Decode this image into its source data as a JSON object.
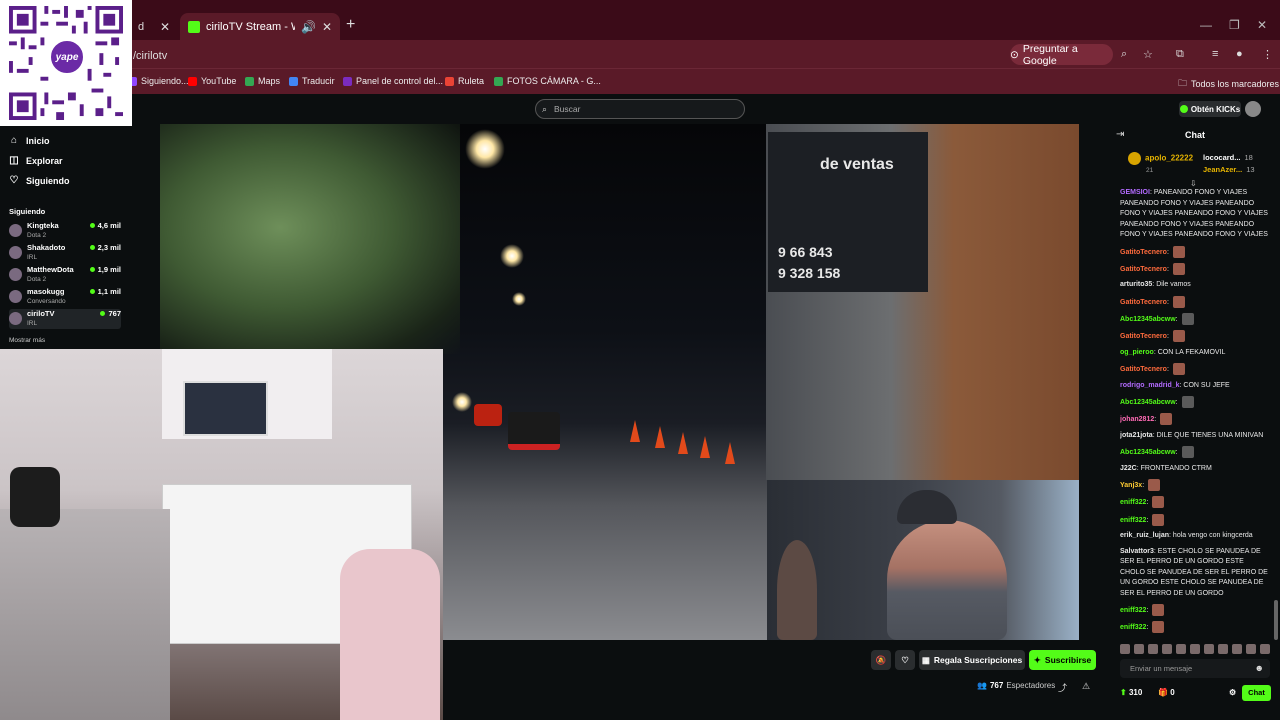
{
  "browser": {
    "tabs": [
      {
        "label": "d",
        "close": "✕"
      },
      {
        "label": "ciriloTV Stream - Watch Live",
        "close": "✕"
      }
    ],
    "new_tab": "+",
    "window_controls": [
      "—",
      "❐",
      "✕"
    ],
    "url": "/cirilotv",
    "google_button": "Preguntar a Google",
    "bookmarks": [
      {
        "label": "Siguiendo...",
        "color": "#9147ff"
      },
      {
        "label": "YouTube",
        "color": "#ff0000"
      },
      {
        "label": "Maps",
        "color": "#34a853"
      },
      {
        "label": "Traducir",
        "color": "#4285f4"
      },
      {
        "label": "Panel de control del...",
        "color": "#7b2cbf"
      },
      {
        "label": "Ruleta",
        "color": "#ea4335"
      },
      {
        "label": "FOTOS CÁMARA - G...",
        "color": "#34a853"
      }
    ],
    "all_bookmarks": "Todos los marcadores"
  },
  "qr": {
    "brand": "yape",
    "brand_color": "#6b2aa6"
  },
  "kick": {
    "search_placeholder": "Buscar",
    "kicks_button": "Obtén KICKs",
    "brand_color": "#53fc18"
  },
  "sidebar": {
    "nav": [
      {
        "label": "Inicio",
        "icon": "home-icon",
        "glyph": "⌂"
      },
      {
        "label": "Explorar",
        "icon": "explore-icon",
        "glyph": "◫"
      },
      {
        "label": "Siguiendo",
        "icon": "heart-icon",
        "glyph": "♡"
      }
    ],
    "section_title": "Siguiendo",
    "channels": [
      {
        "name": "Kingteka",
        "category": "Dota 2",
        "viewers": "4,6 mil"
      },
      {
        "name": "Shakadoto",
        "category": "IRL",
        "viewers": "2,3 mil"
      },
      {
        "name": "MatthewDota",
        "category": "Dota 2",
        "viewers": "1,9 mil"
      },
      {
        "name": "masokugg",
        "category": "Conversando",
        "viewers": "1,1 mil"
      },
      {
        "name": "ciriloTV",
        "category": "IRL",
        "viewers": "767"
      }
    ],
    "show_more": "Mostrar más"
  },
  "video": {
    "sign_top": "de ventas",
    "sign_phone1": "9  66 843",
    "sign_phone2": "9  328 158"
  },
  "controls": {
    "gift_subs": "Regala Suscripciones",
    "subscribe": "Suscribirse",
    "viewer_count": "767",
    "viewer_label": "Espectadores"
  },
  "chat": {
    "title": "Chat",
    "top_gifter": {
      "name": "apolo_22222",
      "count": "21"
    },
    "gifters": [
      {
        "name": "lococard...",
        "count": "18",
        "color": "#ffffff"
      },
      {
        "name": "JeanAzer...",
        "count": "13",
        "color": "#e6b400"
      }
    ],
    "messages": [
      {
        "user": "GEMSIOI",
        "color": "#b36bff",
        "text": "PANEANDO FONO Y VIAJES PANEANDO FONO Y VIAJES PANEANDO FONO Y VIAJES PANEANDO FONO Y VIAJES PANEANDO FONO Y VIAJES PANEANDO FONO Y VIAJES PANEANDO FONO Y VIAJES"
      },
      {
        "user": "GatitoTecnero",
        "color": "#ff6b3d",
        "text": ""
      },
      {
        "user": "GatitoTecnero",
        "color": "#ff6b3d",
        "text": ""
      },
      {
        "user": "arturito35",
        "color": "#e8e8e8",
        "text": "Dile vamos"
      },
      {
        "user": "GatitoTecnero",
        "color": "#ff6b3d",
        "text": ""
      },
      {
        "user": "Abc12345abcww",
        "color": "#53fc18",
        "text": ""
      },
      {
        "user": "GatitoTecnero",
        "color": "#ff6b3d",
        "text": ""
      },
      {
        "user": "og_pieroo",
        "color": "#53fc18",
        "text": "CON LA FEKAMOVIL"
      },
      {
        "user": "GatitoTecnero",
        "color": "#ff6b3d",
        "text": ""
      },
      {
        "user": "rodrigo_madrid_k",
        "color": "#b36bff",
        "text": "CON SU JEFE"
      },
      {
        "user": "Abc12345abcww",
        "color": "#53fc18",
        "text": ""
      },
      {
        "user": "johan2812",
        "color": "#ff6bb5",
        "text": ""
      },
      {
        "user": "jota21jota",
        "color": "#e8e8e8",
        "text": "DILE QUE TIENES UNA MINIVAN"
      },
      {
        "user": "Abc12345abcww",
        "color": "#53fc18",
        "text": ""
      },
      {
        "user": "J22C",
        "color": "#e8e8e8",
        "text": "FRONTEANDO CTRM"
      },
      {
        "user": "Yanj3x",
        "color": "#ffcc33",
        "text": ""
      },
      {
        "user": "eniff322",
        "color": "#53fc18",
        "text": ""
      },
      {
        "user": "eniff322",
        "color": "#53fc18",
        "text": ""
      },
      {
        "user": "erik_ruiz_lujan",
        "color": "#e8e8e8",
        "text": "hola vengo con kingcerda"
      },
      {
        "user": "Salvattor3",
        "color": "#e8e8e8",
        "text": "ESTE CHOLO SE PANUDEA DE SER EL PERRO DE UN GORDO ESTE CHOLO SE PANUDEA DE SER EL PERRO DE UN GORDO ESTE CHOLO SE PANUDEA DE SER EL PERRO DE UN GORDO"
      },
      {
        "user": "eniff322",
        "color": "#53fc18",
        "text": ""
      },
      {
        "user": "eniff322",
        "color": "#53fc18",
        "text": ""
      },
      {
        "user": "eniff322",
        "color": "#53fc18",
        "text": ""
      }
    ],
    "input_placeholder": "Enviar un mensaje",
    "points": "310",
    "gifts": "0",
    "send_label": "Chat"
  }
}
